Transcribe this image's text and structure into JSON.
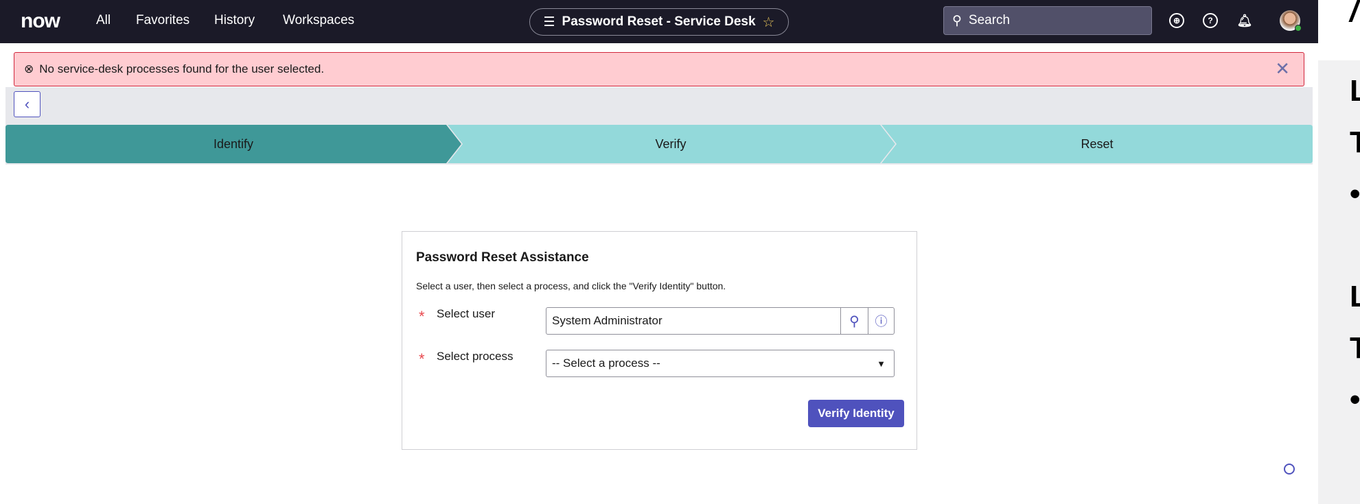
{
  "topbar": {
    "logo": "now",
    "nav": [
      "All",
      "Favorites",
      "History",
      "Workspaces"
    ],
    "title": "Password Reset - Service Desk",
    "search_placeholder": "Search"
  },
  "alert": {
    "message": "No service-desk processes found for the user selected."
  },
  "steps": [
    {
      "label": "Identify",
      "active": true
    },
    {
      "label": "Verify",
      "active": false
    },
    {
      "label": "Reset",
      "active": false
    }
  ],
  "form": {
    "title": "Password Reset Assistance",
    "description": "Select a user, then select a process, and click the \"Verify Identity\" button.",
    "user_label": "Select user",
    "user_value": "System Administrator",
    "process_label": "Select process",
    "process_value": "-- Select a process --",
    "submit": "Verify Identity"
  },
  "side_panel": {
    "glyphs": [
      "L",
      "T",
      "•",
      "L",
      "T",
      "•"
    ]
  },
  "colors": {
    "accent": "#4f52bd",
    "step_active": "#3f9898",
    "step_inactive": "#93d9da",
    "alert_bg": "#ffccd1"
  }
}
